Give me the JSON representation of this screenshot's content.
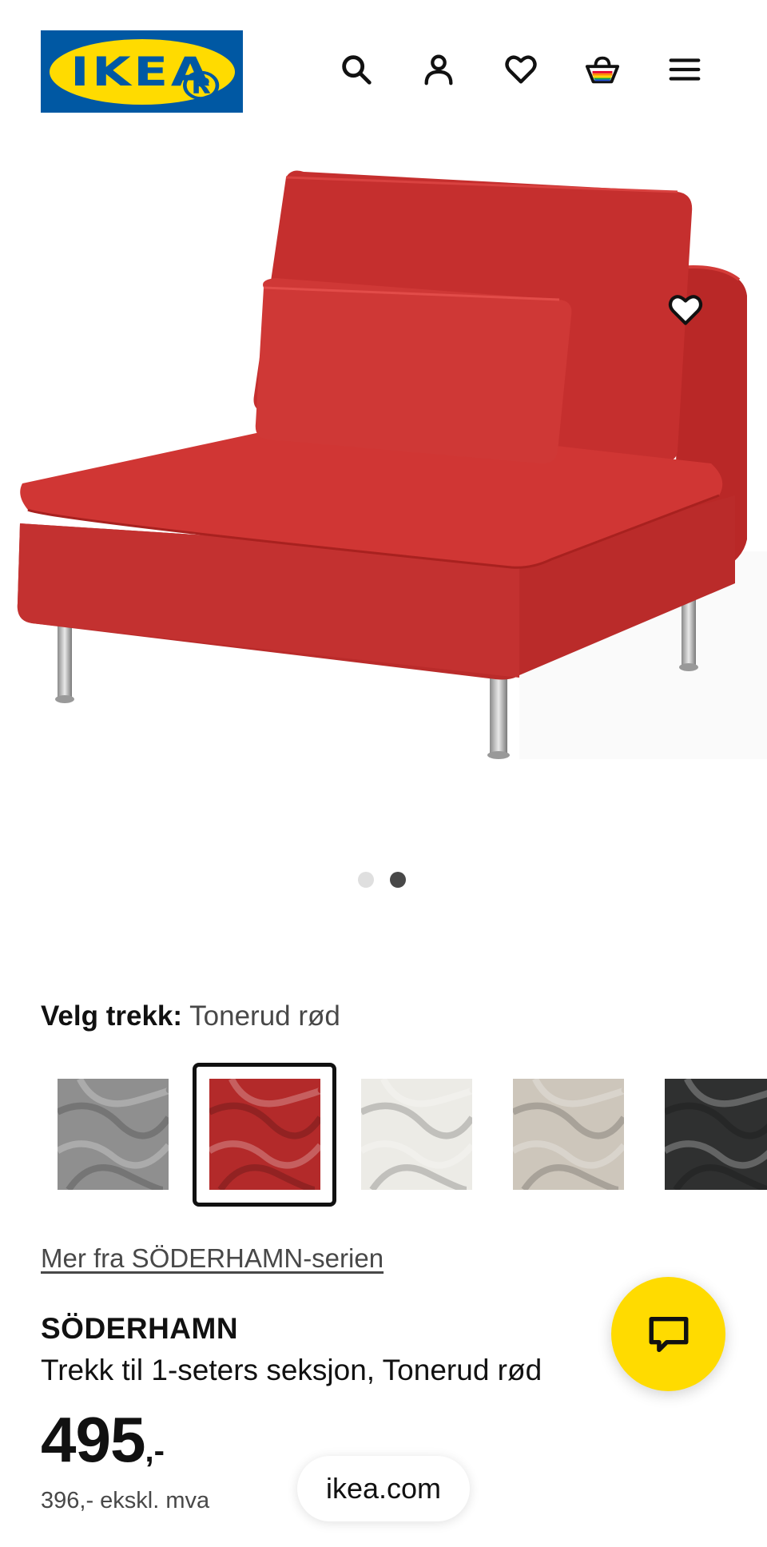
{
  "header": {
    "logo_text": "IKEA",
    "logo_mark": "®",
    "icons": [
      "search-icon",
      "account-icon",
      "heart-icon",
      "basket-icon",
      "menu-icon"
    ]
  },
  "gallery": {
    "image_alt": "",
    "current_slide": 2,
    "slide_count": 2
  },
  "variant": {
    "label": "Velg trekk:",
    "selected": "Tonerud rød",
    "swatch_colors": [
      "#8f8f8f",
      "#b32a2a",
      "#ecebe6",
      "#cdc6bb",
      "#2f3030"
    ],
    "selected_index": 1
  },
  "series_link": "Mer fra SÖDERHAMN-serien",
  "product": {
    "name": "SÖDERHAMN",
    "description": "Trekk til 1-seters seksjon, Tonerud rød",
    "price": "495",
    "price_suffix": ",-",
    "price_ex_vat": "396,- ekskl. mva"
  },
  "browser": {
    "url": "ikea.com"
  },
  "colors": {
    "ikea_blue": "#0058a3",
    "ikea_yellow": "#ffdb00",
    "sofa_red": "#c8302f"
  }
}
